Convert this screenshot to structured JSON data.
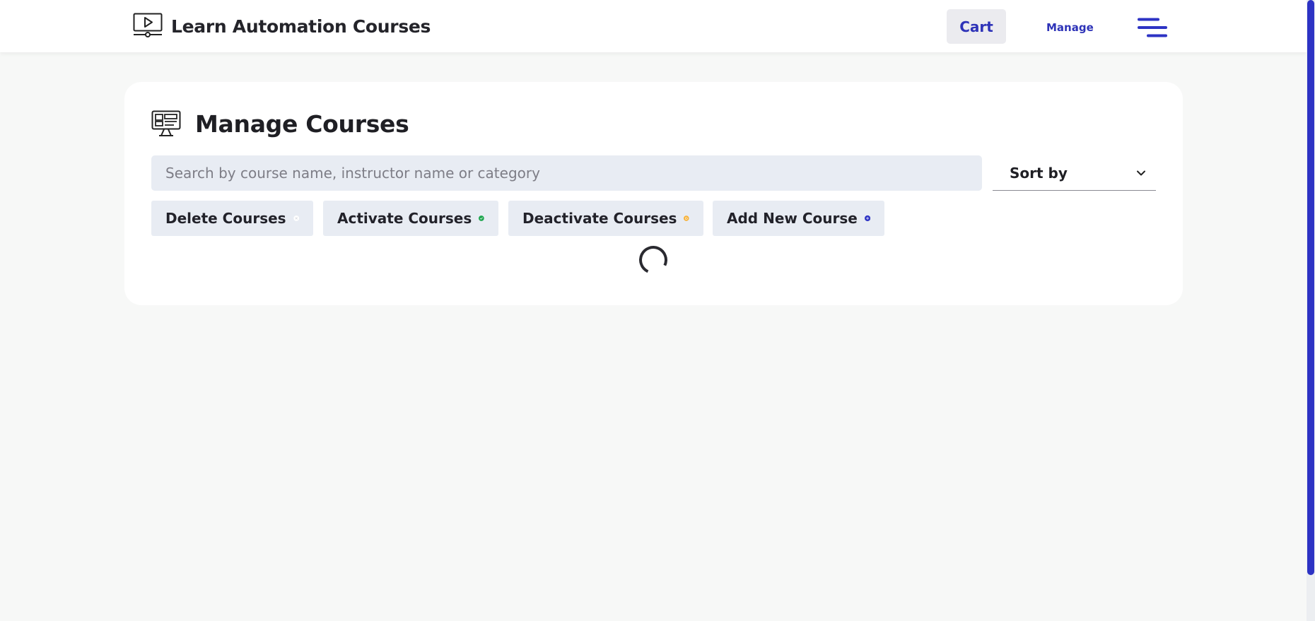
{
  "header": {
    "brand_title": "Learn Automation Courses",
    "brand_icon": "video-player-icon",
    "cart_label": "Cart",
    "manage_label": "Manage",
    "menu_icon": "hamburger-menu-icon"
  },
  "main": {
    "page_title": "Manage Courses",
    "title_icon": "monitor-dashboard-icon",
    "search": {
      "placeholder": "Search by course name, instructor name or category",
      "value": ""
    },
    "sort": {
      "label": "Sort by",
      "icon": "chevron-down-icon"
    },
    "actions": [
      {
        "label": "Delete Courses",
        "icon": "close-circle-icon",
        "color": "#ffffff"
      },
      {
        "label": "Activate Courses",
        "icon": "check-circle-icon",
        "color": "#1fa64f"
      },
      {
        "label": "Deactivate Courses",
        "icon": "power-circle-icon",
        "color": "#f7b034"
      },
      {
        "label": "Add New Course",
        "icon": "plus-circle-icon",
        "color": "#2d33c4"
      }
    ],
    "loading": true
  },
  "colors": {
    "accent": "#2e33b8",
    "page_background": "#f7f8f7",
    "control_background": "#e8ecf3",
    "scrollbar": "#2d33c4"
  }
}
